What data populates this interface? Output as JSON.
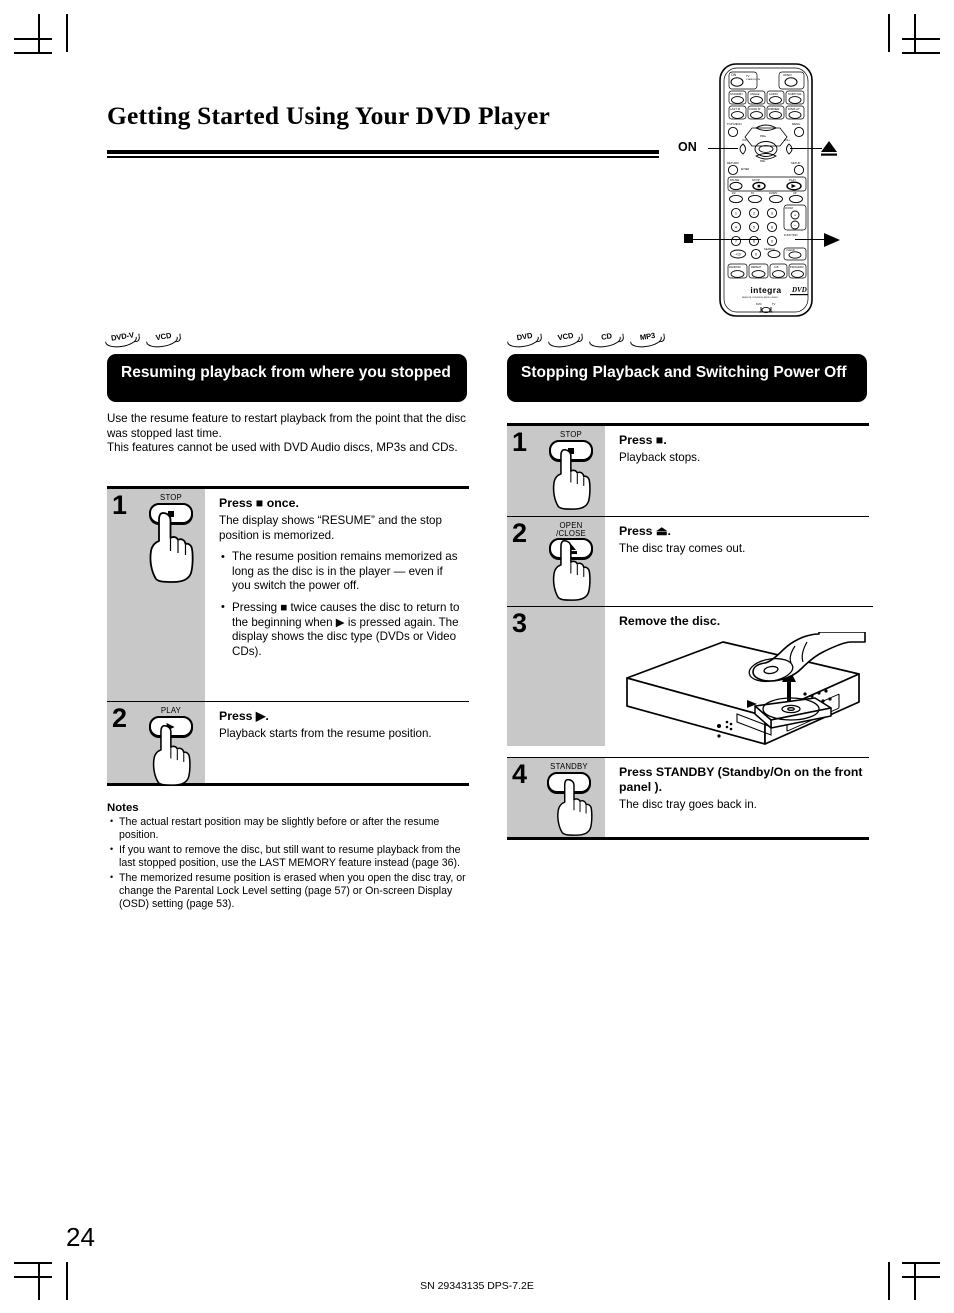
{
  "document": {
    "title": "Getting Started Using Your DVD Player",
    "page_number": "24",
    "footer": "SN 29343135 DPS-7.2E"
  },
  "remote_illustration": {
    "caption_on": "ON",
    "caption_stop": "■",
    "caption_eject": "▲",
    "caption_play": "▶",
    "brand": "integra",
    "logo": "DVD"
  },
  "left_section": {
    "badges": [
      "DVD-V",
      "VCD"
    ],
    "heading": "Resuming playback from where you stopped",
    "intro": "Use the resume feature to restart playback from the point that the disc was stopped last time.\nThis features cannot be used with DVD Audio discs, MP3s and CDs.",
    "steps": [
      {
        "number": "1",
        "button_label": "STOP",
        "button_glyph": "square",
        "head": "Press ■ once.",
        "desc": "The display shows “RESUME” and the stop position is memorized.",
        "bullets": [
          "The resume position remains memorized as long as the disc is in the player — even if you switch the power off.",
          "Pressing ■ twice causes the disc to return to the beginning when ▶ is pressed again. The display shows the disc type (DVDs or Video CDs)."
        ]
      },
      {
        "number": "2",
        "button_label": "PLAY",
        "button_glyph": "play",
        "head": "Press ▶.",
        "desc": "Playback starts from the resume position.",
        "bullets": []
      }
    ],
    "notes_title": "Notes",
    "notes": [
      "The actual restart position may be slightly before or after the resume position.",
      "If you want to remove the disc, but still want to resume playback from the last stopped position, use the LAST MEMORY feature instead  (page 36).",
      "The memorized resume position is erased when you open the disc tray, or change the Parental Lock Level setting  (page 57)  or On-screen Display (OSD) setting (page 53)."
    ]
  },
  "right_section": {
    "badges": [
      "DVD",
      "VCD",
      "CD",
      "MP3"
    ],
    "heading": "Stopping Playback and Switching Power Off",
    "steps": [
      {
        "number": "1",
        "button_label": "STOP",
        "button_glyph": "square",
        "head": "Press ■.",
        "desc": "Playback stops."
      },
      {
        "number": "2",
        "button_label": "OPEN\n/CLOSE",
        "button_glyph": "eject",
        "head": "Press ⏏.",
        "desc": "The disc tray comes out."
      },
      {
        "number": "3",
        "button_label": "",
        "button_glyph": "none",
        "head": "Remove the disc.",
        "desc": ""
      },
      {
        "number": "4",
        "button_label": "STANDBY",
        "button_glyph": "power",
        "head": "Press STANDBY (Standby/On on the front panel ).",
        "desc": "The disc tray goes back in."
      }
    ]
  }
}
